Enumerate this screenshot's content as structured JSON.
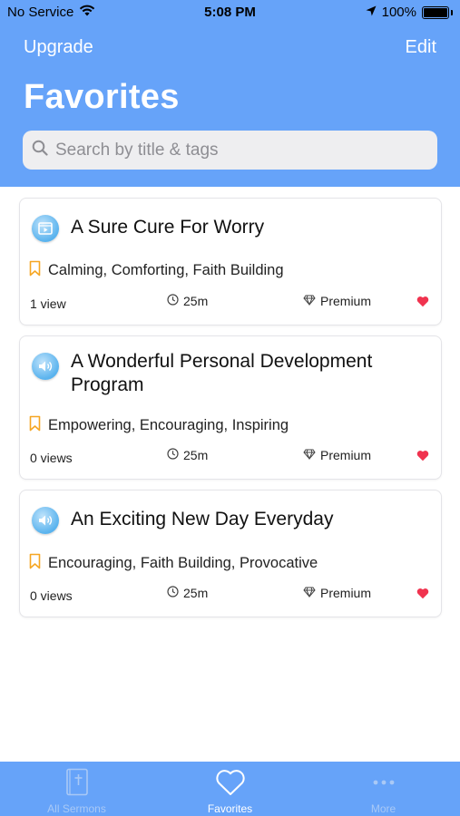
{
  "status_bar": {
    "carrier": "No Service",
    "time": "5:08 PM",
    "battery": "100%"
  },
  "nav": {
    "left": "Upgrade",
    "right": "Edit",
    "title": "Favorites"
  },
  "search": {
    "placeholder": "Search by title & tags"
  },
  "sermons": [
    {
      "type": "video",
      "title": "A Sure Cure For Worry",
      "tags": "Calming, Comforting, Faith Building",
      "views": "1 view",
      "duration": "25m",
      "tier": "Premium",
      "icon": "video-play-icon"
    },
    {
      "type": "audio",
      "title": "A Wonderful Personal Development Program",
      "tags": "Empowering, Encouraging, Inspiring",
      "views": "0 views",
      "duration": "25m",
      "tier": "Premium",
      "icon": "speaker-icon"
    },
    {
      "type": "audio",
      "title": "An Exciting New Day Everyday",
      "tags": "Encouraging, Faith Building, Provocative",
      "views": "0 views",
      "duration": "25m",
      "tier": "Premium",
      "icon": "speaker-icon"
    }
  ],
  "tabs": [
    {
      "label": "All Sermons",
      "icon": "bible-icon",
      "active": false
    },
    {
      "label": "Favorites",
      "icon": "heart-icon",
      "active": true
    },
    {
      "label": "More",
      "icon": "ellipsis-icon",
      "active": false
    }
  ],
  "colors": {
    "brand": "#66a3f9",
    "heart": "#f0334f",
    "bookmark": "#f5a623"
  }
}
